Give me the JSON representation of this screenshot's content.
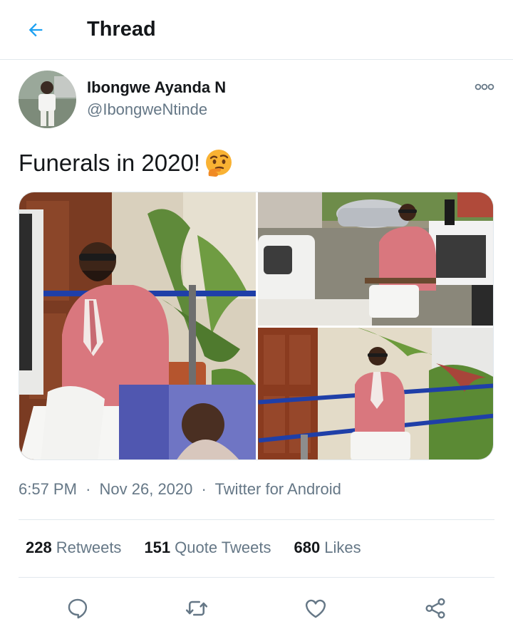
{
  "header": {
    "title": "Thread"
  },
  "tweet": {
    "author": {
      "display_name": "Ibongwe Ayanda N",
      "handle": "@IbongweNtinde"
    },
    "text": "Funerals in 2020!",
    "emoji": "thinking-face-emoji",
    "photos": [
      {
        "description": "photo-1"
      },
      {
        "description": "photo-2"
      },
      {
        "description": "photo-3"
      }
    ],
    "meta": {
      "time": "6:57 PM",
      "separator": "·",
      "date": "Nov 26, 2020",
      "source": "Twitter for Android"
    },
    "stats": {
      "retweets_count": "228",
      "retweets_label": "Retweets",
      "quotes_count": "151",
      "quotes_label": "Quote Tweets",
      "likes_count": "680",
      "likes_label": "Likes"
    }
  },
  "icons": {
    "back": "back-arrow-icon",
    "more": "more-options-icon",
    "reply": "reply-icon",
    "retweet": "retweet-icon",
    "like": "like-icon",
    "share": "share-icon"
  },
  "colors": {
    "accent": "#1da1f2",
    "icon_gray": "#657786",
    "divider": "#e1e8ed",
    "suit_pink": "#d9777e"
  }
}
